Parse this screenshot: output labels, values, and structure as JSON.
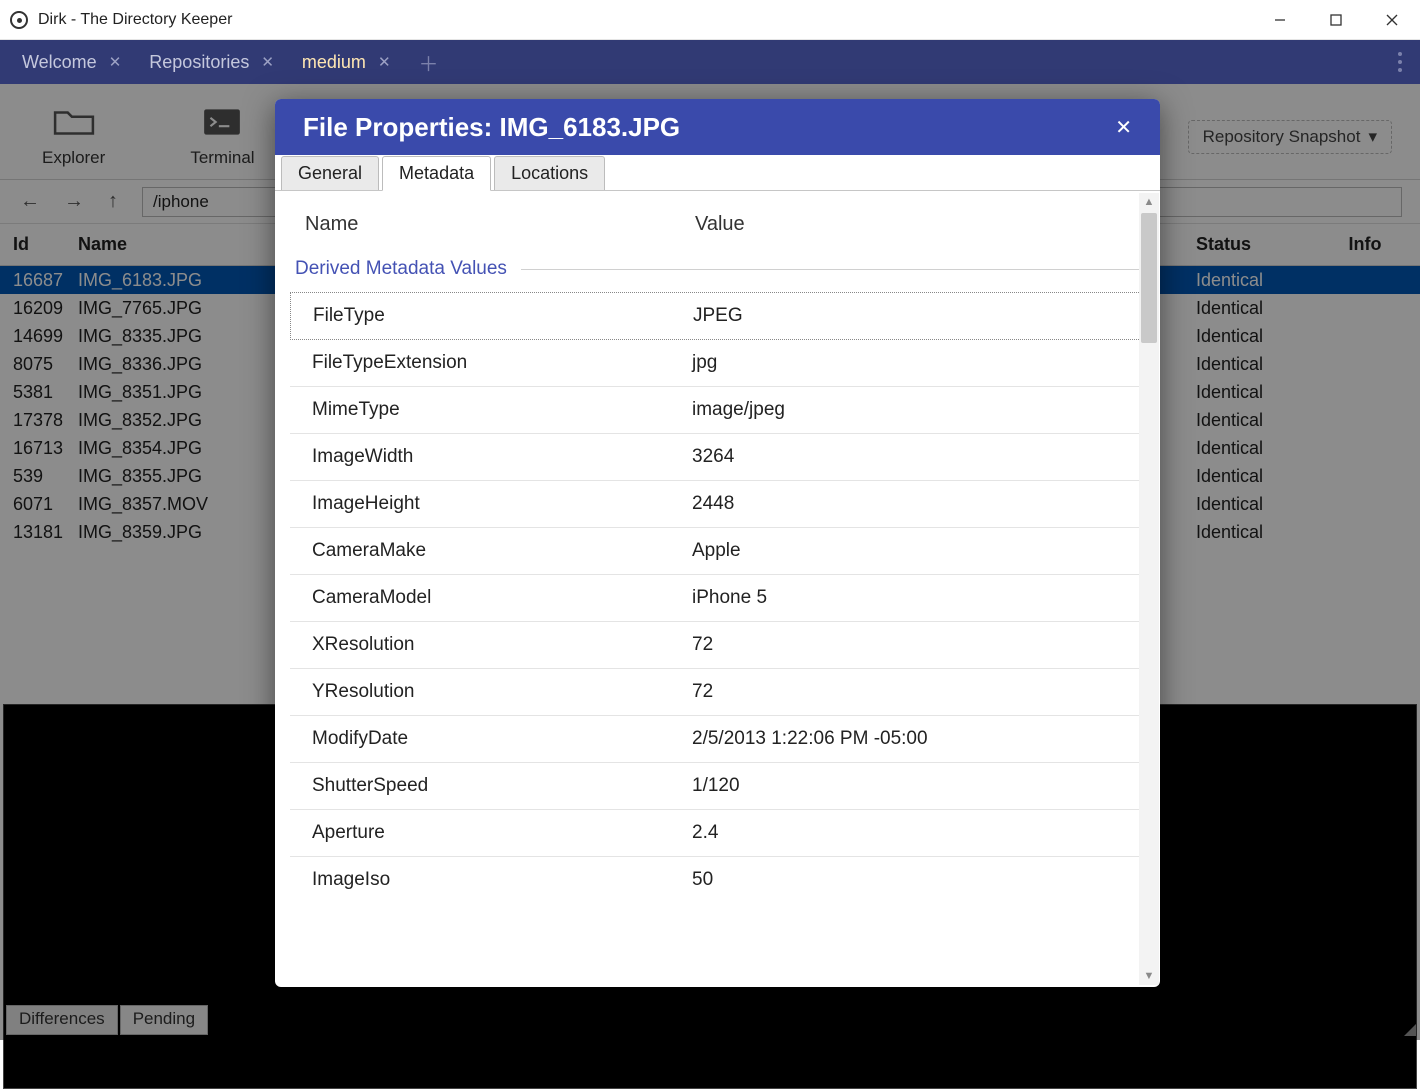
{
  "window": {
    "title": "Dirk - The Directory Keeper"
  },
  "tabs": [
    {
      "label": "Welcome",
      "closable": true
    },
    {
      "label": "Repositories",
      "closable": true
    },
    {
      "label": "medium",
      "closable": true,
      "active": true
    }
  ],
  "toolbar": {
    "explorer": "Explorer",
    "terminal": "Terminal",
    "snapshot": "Repository Snapshot"
  },
  "path": {
    "value": "/iphone"
  },
  "table": {
    "headers": {
      "id": "Id",
      "name": "Name",
      "status": "Status",
      "info": "Info"
    },
    "rows": [
      {
        "id": "16687",
        "name": "IMG_6183.JPG",
        "status": "Identical",
        "selected": true
      },
      {
        "id": "16209",
        "name": "IMG_7765.JPG",
        "status": "Identical"
      },
      {
        "id": "14699",
        "name": "IMG_8335.JPG",
        "status": "Identical"
      },
      {
        "id": "8075",
        "name": "IMG_8336.JPG",
        "status": "Identical"
      },
      {
        "id": "5381",
        "name": "IMG_8351.JPG",
        "status": "Identical"
      },
      {
        "id": "17378",
        "name": "IMG_8352.JPG",
        "status": "Identical"
      },
      {
        "id": "16713",
        "name": "IMG_8354.JPG",
        "status": "Identical"
      },
      {
        "id": "539",
        "name": "IMG_8355.JPG",
        "status": "Identical"
      },
      {
        "id": "6071",
        "name": "IMG_8357.MOV",
        "status": "Identical"
      },
      {
        "id": "13181",
        "name": "IMG_8359.JPG",
        "status": "Identical"
      }
    ]
  },
  "bottom_tabs": {
    "differences": "Differences",
    "pending": "Pending"
  },
  "dialog": {
    "title": "File Properties: IMG_6183.JPG",
    "tabs": {
      "general": "General",
      "metadata": "Metadata",
      "locations": "Locations"
    },
    "columns": {
      "name": "Name",
      "value": "Value"
    },
    "section": "Derived Metadata Values",
    "rows": [
      {
        "k": "FileType",
        "v": "JPEG"
      },
      {
        "k": "FileTypeExtension",
        "v": "jpg"
      },
      {
        "k": "MimeType",
        "v": "image/jpeg"
      },
      {
        "k": "ImageWidth",
        "v": "3264"
      },
      {
        "k": "ImageHeight",
        "v": "2448"
      },
      {
        "k": "CameraMake",
        "v": "Apple"
      },
      {
        "k": "CameraModel",
        "v": "iPhone 5"
      },
      {
        "k": "XResolution",
        "v": "72"
      },
      {
        "k": "YResolution",
        "v": "72"
      },
      {
        "k": "ModifyDate",
        "v": "2/5/2013 1:22:06 PM -05:00"
      },
      {
        "k": "ShutterSpeed",
        "v": "1/120"
      },
      {
        "k": "Aperture",
        "v": "2.4"
      },
      {
        "k": "ImageIso",
        "v": "50"
      }
    ]
  }
}
